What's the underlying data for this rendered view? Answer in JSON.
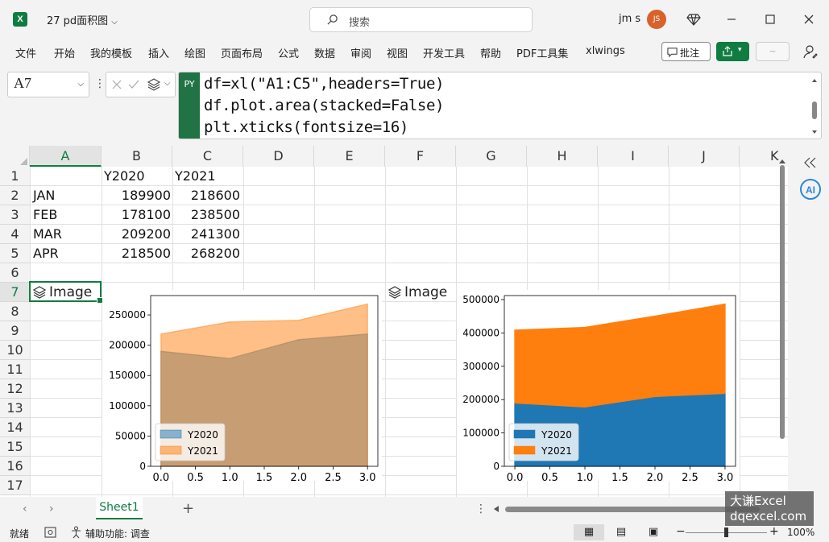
{
  "window": {
    "app_icon": "X",
    "title": "27 pd面积图",
    "search_placeholder": "搜索",
    "user_name": "jm s",
    "avatar_initials": "JS"
  },
  "ribbon": {
    "tabs": [
      "文件",
      "开始",
      "我的模板",
      "插入",
      "绘图",
      "页面布局",
      "公式",
      "数据",
      "审阅",
      "视图",
      "开发工具",
      "帮助",
      "PDF工具集",
      "xlwings"
    ],
    "comments_label": "批注"
  },
  "formula_bar": {
    "name_box": "A7",
    "badge": "PY",
    "code_lines": [
      "df=xl(\"A1:C5\",headers=True)",
      "df.plot.area(stacked=False)",
      "plt.xticks(fontsize=16)"
    ]
  },
  "grid": {
    "columns": [
      "A",
      "B",
      "C",
      "D",
      "E",
      "F",
      "G",
      "H",
      "I",
      "J",
      "K"
    ],
    "rows": [
      "1",
      "2",
      "3",
      "4",
      "5",
      "6",
      "7",
      "8",
      "9",
      "10",
      "11",
      "12",
      "13",
      "14",
      "15",
      "16",
      "17"
    ],
    "selected_column": "A",
    "selected_row": "7",
    "header_row": [
      "",
      "Y2020",
      "Y2021"
    ],
    "data_rows": [
      [
        "JAN",
        "189900",
        "218600"
      ],
      [
        "FEB",
        "178100",
        "238500"
      ],
      [
        "MAR",
        "209200",
        "241300"
      ],
      [
        "APR",
        "218500",
        "268200"
      ]
    ],
    "image_labels": [
      "Image",
      "Image"
    ]
  },
  "chart_data": [
    {
      "type": "area",
      "stacked": false,
      "x": [
        0,
        1,
        2,
        3
      ],
      "series": [
        {
          "name": "Y2020",
          "values": [
            189900,
            178100,
            209200,
            218500
          ],
          "color": "#1f77b4"
        },
        {
          "name": "Y2021",
          "values": [
            218600,
            238500,
            241300,
            268200
          ],
          "color": "#ff7f0e"
        }
      ],
      "xticks": [
        "0.0",
        "0.5",
        "1.0",
        "1.5",
        "2.0",
        "2.5",
        "3.0"
      ],
      "yticks": [
        "0",
        "50000",
        "100000",
        "150000",
        "200000",
        "250000"
      ],
      "xlim": [
        -0.15,
        3.15
      ],
      "ylim": [
        0,
        282000
      ],
      "legend": "lower-left"
    },
    {
      "type": "area",
      "stacked": true,
      "x": [
        0,
        1,
        2,
        3
      ],
      "series": [
        {
          "name": "Y2020",
          "values": [
            189900,
            178100,
            209200,
            218500
          ],
          "color": "#1f77b4"
        },
        {
          "name": "Y2021",
          "values": [
            218600,
            238500,
            241300,
            268200
          ],
          "color": "#ff7f0e"
        }
      ],
      "xticks": [
        "0.0",
        "0.5",
        "1.0",
        "1.5",
        "2.0",
        "2.5",
        "3.0"
      ],
      "yticks": [
        "0",
        "100000",
        "200000",
        "300000",
        "400000",
        "500000"
      ],
      "xlim": [
        -0.15,
        3.15
      ],
      "ylim": [
        0,
        512000
      ],
      "legend": "lower-left"
    }
  ],
  "sheets": {
    "active": "Sheet1"
  },
  "status": {
    "ready": "就绪",
    "accessibility": "辅助功能: 调查",
    "zoom": "100%"
  },
  "watermark": {
    "line1": "大谦Excel",
    "line2": "dqexcel.com"
  }
}
